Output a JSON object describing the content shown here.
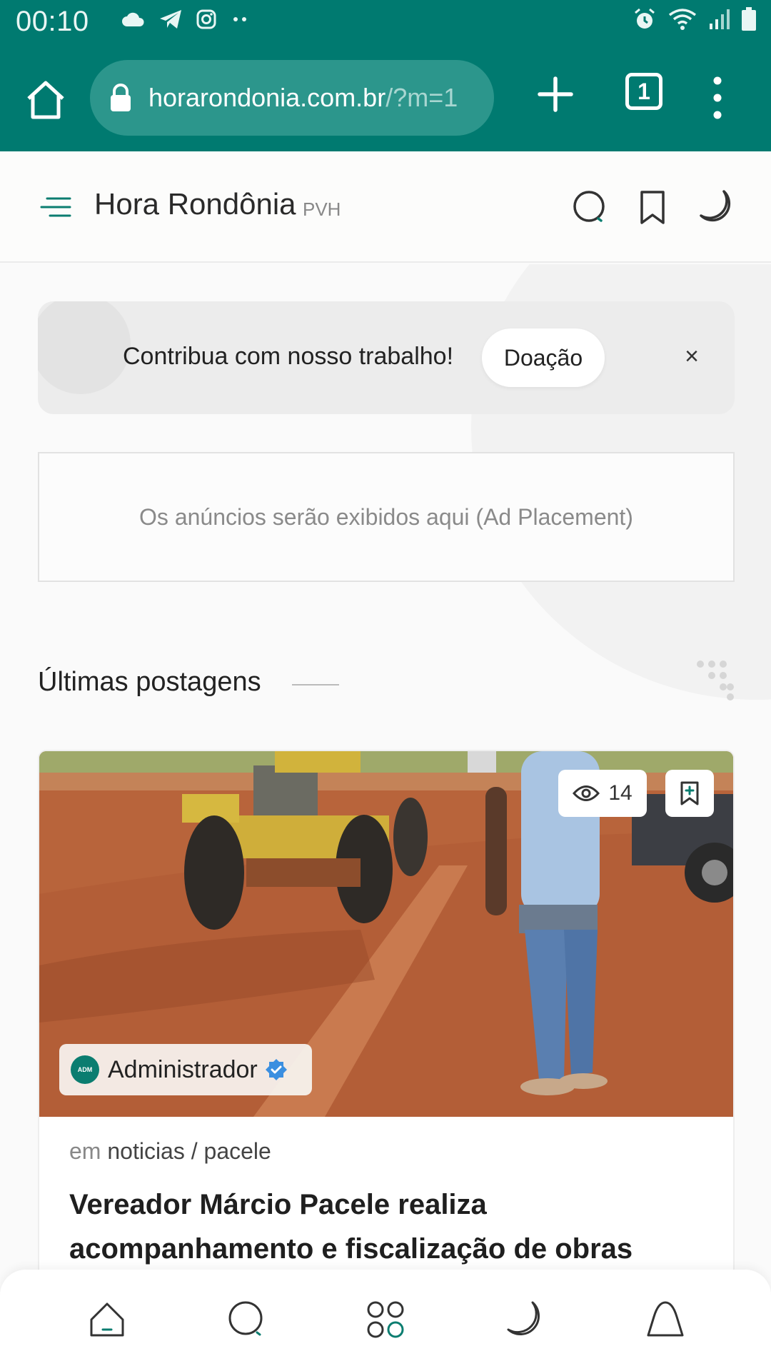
{
  "status_bar": {
    "time": "00:10",
    "left_icons": [
      "cloud-icon",
      "telegram-icon",
      "instagram-icon",
      "more-dots-icon"
    ],
    "right_icons": [
      "alarm-icon",
      "wifi-icon",
      "signal-icon",
      "battery-icon"
    ]
  },
  "browser": {
    "url_main": "horarondonia.com.br",
    "url_rest": "/?m=1",
    "tab_count": "1"
  },
  "header": {
    "title": "Hora Rondônia",
    "subtitle": "PVH"
  },
  "donation": {
    "text": "Contribua com nosso trabalho!",
    "button_label": "Doação",
    "close_label": "×"
  },
  "ad": {
    "text": "Os anúncios serão exibidos aqui (Ad Placement)"
  },
  "section": {
    "title": "Últimas postagens"
  },
  "post": {
    "views": "14",
    "author": "Administrador",
    "avatar_text": "ADM",
    "meta_prefix": "em",
    "categories": "noticias / pacele",
    "title": "Vereador Márcio Pacele realiza acompanhamento e fiscalização de obras"
  },
  "colors": {
    "brand": "#007a70",
    "url_pill": "#2c968c",
    "accent_teal": "#0b7d70",
    "verified": "#3b8fe0"
  },
  "bottom_nav": [
    "home-icon",
    "search-icon",
    "apps-grid-icon",
    "moon-icon",
    "notification-icon"
  ]
}
